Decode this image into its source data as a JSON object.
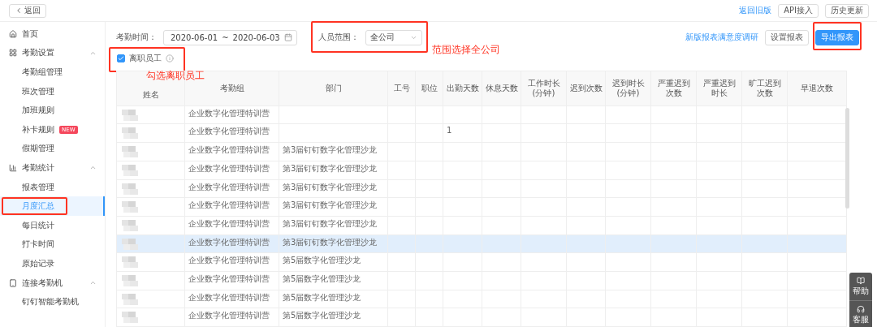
{
  "top_bar": {
    "back_button": "返回",
    "links": [
      {
        "label": "返回旧版",
        "kind": "link"
      },
      {
        "label": "API接入",
        "kind": "button"
      },
      {
        "label": "历史更新",
        "kind": "button"
      }
    ]
  },
  "sidebar": {
    "items": [
      {
        "label": "首页",
        "kind": "link"
      },
      {
        "label": "考勤设置",
        "kind": "group",
        "expanded": true,
        "children": [
          {
            "label": "考勤组管理",
            "selected": false
          },
          {
            "label": "班次管理",
            "selected": false
          },
          {
            "label": "加班规则",
            "selected": false
          },
          {
            "label": "补卡规则",
            "badge": "NEW",
            "selected": false
          },
          {
            "label": "假期管理",
            "selected": false
          }
        ]
      },
      {
        "label": "考勤统计",
        "kind": "group",
        "expanded": true,
        "children": [
          {
            "label": "报表管理",
            "selected": false
          },
          {
            "label": "月度汇总",
            "selected": true
          },
          {
            "label": "每日统计",
            "selected": false
          },
          {
            "label": "打卡时间",
            "selected": false
          },
          {
            "label": "原始记录",
            "selected": false
          }
        ]
      },
      {
        "label": "连接考勤机",
        "kind": "group",
        "expanded": true,
        "children": [
          {
            "label": "钉钉智能考勤机",
            "selected": false
          }
        ]
      }
    ]
  },
  "filters": {
    "date_label": "考勤时间：",
    "date_start": "2020-06-01",
    "date_separator": "~",
    "date_end": "2020-06-03",
    "scope_label": "人员范围：",
    "scope_value": "全公司",
    "resigned_checkbox": {
      "label": "离职员工",
      "checked": true
    }
  },
  "actions": {
    "survey_link": "新版报表满意度调研",
    "settings_button": "设置报表",
    "export_button": "导出报表"
  },
  "table": {
    "columns": [
      "姓名",
      "考勤组",
      "部门",
      "工号",
      "职位",
      "出勤天数",
      "休息天数",
      "工作时长(分钟)",
      "迟到次数",
      "迟到时长(分钟)",
      "严重迟到次数",
      "严重迟到时长",
      "旷工迟到次数",
      "早退次数"
    ],
    "rows": [
      {
        "cells": [
          "",
          "企业数字化管理特训营",
          "",
          "",
          "",
          "",
          "",
          "",
          "",
          "",
          "",
          "",
          "",
          ""
        ],
        "highlighted": false
      },
      {
        "cells": [
          "",
          "企业数字化管理特训营",
          "",
          "",
          "",
          "1",
          "",
          "",
          "",
          "",
          "",
          "",
          "",
          ""
        ],
        "highlighted": false
      },
      {
        "cells": [
          "",
          "企业数字化管理特训营",
          "第3届钉钉数字化管理沙龙",
          "",
          "",
          "",
          "",
          "",
          "",
          "",
          "",
          "",
          "",
          ""
        ],
        "highlighted": false
      },
      {
        "cells": [
          "",
          "企业数字化管理特训营",
          "第3届钉钉数字化管理沙龙",
          "",
          "",
          "",
          "",
          "",
          "",
          "",
          "",
          "",
          "",
          ""
        ],
        "highlighted": false
      },
      {
        "cells": [
          "",
          "企业数字化管理特训营",
          "第3届钉钉数字化管理沙龙",
          "",
          "",
          "",
          "",
          "",
          "",
          "",
          "",
          "",
          "",
          ""
        ],
        "highlighted": false
      },
      {
        "cells": [
          "",
          "企业数字化管理特训营",
          "第3届钉钉数字化管理沙龙",
          "",
          "",
          "",
          "",
          "",
          "",
          "",
          "",
          "",
          "",
          ""
        ],
        "highlighted": false
      },
      {
        "cells": [
          "",
          "企业数字化管理特训营",
          "第3届钉钉数字化管理沙龙",
          "",
          "",
          "",
          "",
          "",
          "",
          "",
          "",
          "",
          "",
          ""
        ],
        "highlighted": false
      },
      {
        "cells": [
          "",
          "企业数字化管理特训营",
          "第3届钉钉数字化管理沙龙",
          "",
          "",
          "",
          "",
          "",
          "",
          "",
          "",
          "",
          "",
          ""
        ],
        "highlighted": true
      },
      {
        "cells": [
          "",
          "企业数字化管理特训营",
          "第5届数字化管理沙龙",
          "",
          "",
          "",
          "",
          "",
          "",
          "",
          "",
          "",
          "",
          ""
        ],
        "highlighted": false
      },
      {
        "cells": [
          "",
          "企业数字化管理特训营",
          "第5届数字化管理沙龙",
          "",
          "",
          "",
          "",
          "",
          "",
          "",
          "",
          "",
          "",
          ""
        ],
        "highlighted": false
      },
      {
        "cells": [
          "",
          "企业数字化管理特训营",
          "第5届数字化管理沙龙",
          "",
          "",
          "",
          "",
          "",
          "",
          "",
          "",
          "",
          "",
          ""
        ],
        "highlighted": false
      },
      {
        "cells": [
          "",
          "企业数字化管理特训营",
          "第5届数字化管理沙龙",
          "",
          "",
          "",
          "",
          "",
          "",
          "",
          "",
          "",
          "",
          ""
        ],
        "highlighted": false
      }
    ]
  },
  "help_widget": [
    "帮助",
    "客服"
  ],
  "annotations": [
    "范围选择全公司",
    "勾选离职员工"
  ]
}
